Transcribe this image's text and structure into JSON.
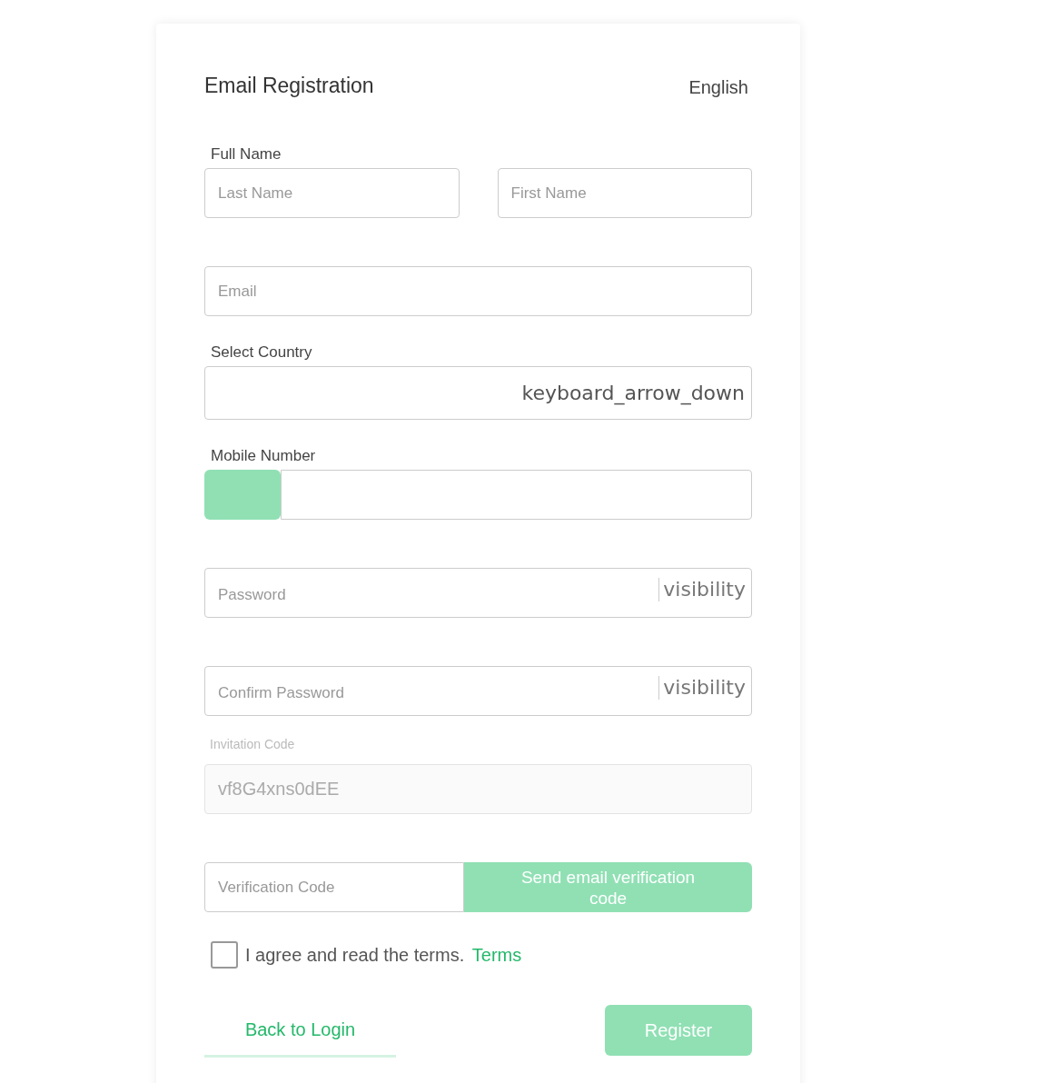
{
  "title": "Email Registration",
  "language": "English",
  "fields": [
    {
      "kind": "name_pair",
      "label": "Full Name",
      "inputs": [
        {
          "placeholder": "Last Name"
        },
        {
          "placeholder": "First Name"
        }
      ]
    },
    {
      "kind": "text",
      "placeholder": "Email"
    },
    {
      "kind": "select",
      "label": "Select Country",
      "arrow": "keyboard_arrow_down"
    },
    {
      "kind": "phone",
      "label": "Mobile Number"
    },
    {
      "kind": "password",
      "placeholder": "Password",
      "toggle": "visibility"
    },
    {
      "kind": "password",
      "placeholder": "Confirm Password",
      "toggle": "visibility"
    },
    {
      "kind": "readonly",
      "label": "Invitation Code",
      "value": "vf8G4xns0dEE"
    },
    {
      "kind": "verify",
      "placeholder": "Verification Code",
      "button": {
        "label": "Send email verification code",
        "disabled": true
      }
    }
  ],
  "agree": {
    "checked": false,
    "text": "I agree and read the terms.",
    "link": "Terms"
  },
  "back_link": "Back to Login",
  "register": {
    "label": "Register",
    "disabled": true
  }
}
